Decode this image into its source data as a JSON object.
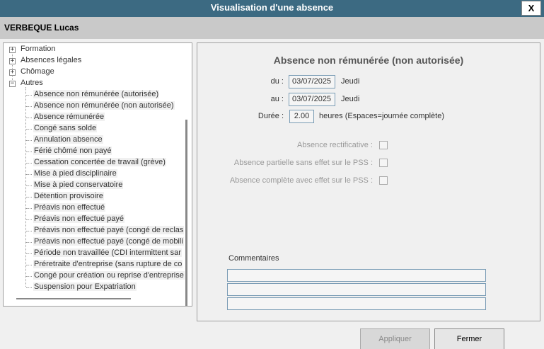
{
  "window": {
    "title": "Visualisation d'une absence",
    "close_label": "X"
  },
  "user": "VERBEQUE Lucas",
  "tree": {
    "groups": [
      {
        "label": "Formation",
        "expander": "+"
      },
      {
        "label": "Absences légales",
        "expander": "+"
      },
      {
        "label": "Chômage",
        "expander": "+"
      },
      {
        "label": "Autres",
        "expander": "−"
      }
    ],
    "children": [
      "Absence non rémunérée (autorisée)",
      "Absence non rémunérée (non autorisée)",
      "Absence rémunérée",
      "Congé sans solde",
      "Annulation absence",
      "Férié chômé non payé",
      "Cessation concertée de travail (grève)",
      "Mise à pied disciplinaire",
      "Mise à pied conservatoire",
      "Détention provisoire",
      "Préavis non effectué",
      "Préavis non effectué payé",
      "Préavis non effectué payé (congé de reclas",
      "Préavis non effectué payé (congé de mobili",
      "Période non travaillée (CDI intermittent sar",
      "Préretraite d'entreprise (sans rupture de co",
      "Congé pour création ou reprise d'entreprise",
      "Suspension pour Expatriation"
    ]
  },
  "detail": {
    "heading": "Absence non rémunérée (non autorisée)",
    "du_label": "du :",
    "du_value": "03/07/2025",
    "du_day": "Jeudi",
    "au_label": "au :",
    "au_value": "03/07/2025",
    "au_day": "Jeudi",
    "duree_label": "Durée :",
    "duree_value": "2.00",
    "duree_unit": "heures (Espaces=journée complète)",
    "checkboxes": [
      {
        "label": "Absence rectificative :",
        "checked": false
      },
      {
        "label": "Absence partielle sans effet sur le PSS :",
        "checked": false
      },
      {
        "label": "Absence complète avec effet sur le PSS :",
        "checked": false
      }
    ],
    "comments_label": "Commentaires",
    "comments": [
      "",
      "",
      ""
    ]
  },
  "buttons": {
    "apply": "Appliquer",
    "close": "Fermer"
  }
}
